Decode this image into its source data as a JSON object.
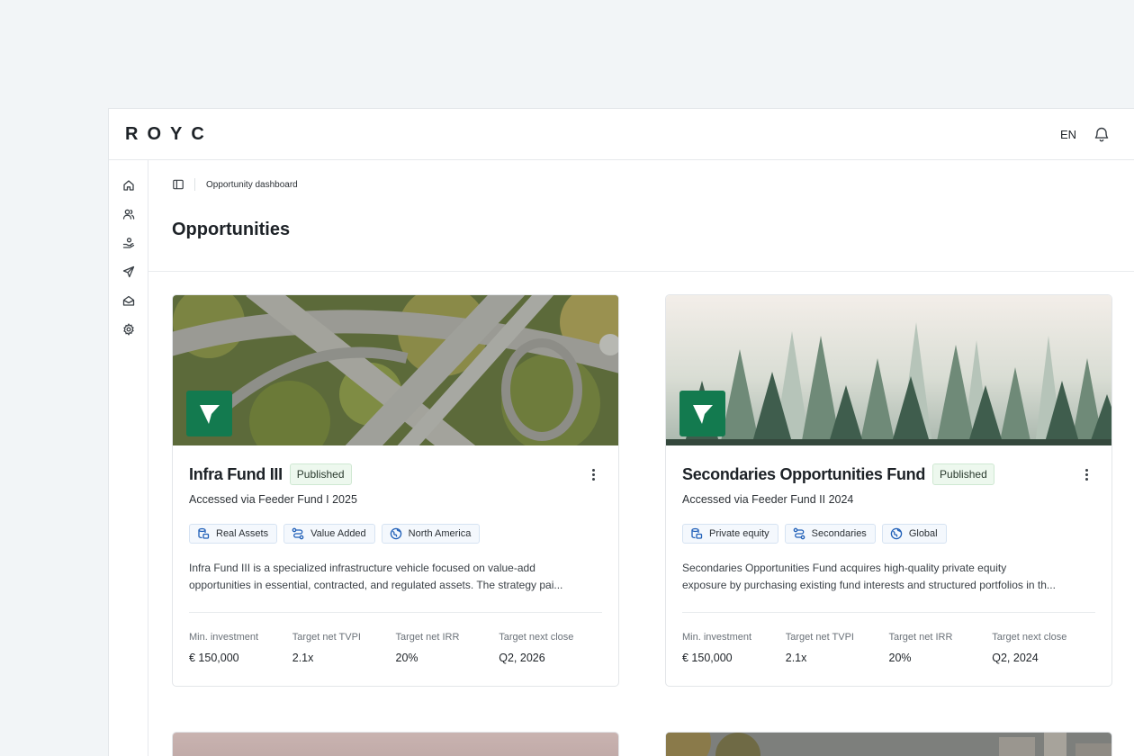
{
  "app": {
    "logo": "ROYC",
    "language": "EN"
  },
  "breadcrumb": {
    "current": "Opportunity dashboard"
  },
  "page": {
    "title": "Opportunities"
  },
  "cards": [
    {
      "title": "Infra Fund III",
      "status": "Published",
      "subtitle": "Accessed via Feeder Fund I 2025",
      "tags": [
        {
          "icon": "asset-class-icon",
          "label": "Real Assets"
        },
        {
          "icon": "strategy-icon",
          "label": "Value Added"
        },
        {
          "icon": "globe-icon",
          "label": "North America"
        }
      ],
      "description_line1": "Infra Fund III is a specialized infrastructure vehicle focused on value-add",
      "description_line2": "opportunities in essential, contracted, and regulated assets. The strategy pai...",
      "metrics": [
        {
          "label": "Min. investment",
          "value": "€ 150,000"
        },
        {
          "label": "Target net TVPI",
          "value": "2.1x"
        },
        {
          "label": "Target net IRR",
          "value": "20%"
        },
        {
          "label": "Target next close",
          "value": "Q2, 2026"
        }
      ]
    },
    {
      "title": "Secondaries Opportunities Fund",
      "status": "Published",
      "subtitle": "Accessed via Feeder Fund II 2024",
      "tags": [
        {
          "icon": "asset-class-icon",
          "label": "Private equity"
        },
        {
          "icon": "strategy-icon",
          "label": "Secondaries"
        },
        {
          "icon": "globe-icon",
          "label": "Global"
        }
      ],
      "description_line1": "Secondaries Opportunities Fund acquires high-quality private equity",
      "description_line2": "exposure by purchasing existing fund interests and structured portfolios in th...",
      "metrics": [
        {
          "label": "Min. investment",
          "value": "€ 150,000"
        },
        {
          "label": "Target net TVPI",
          "value": "2.1x"
        },
        {
          "label": "Target net IRR",
          "value": "20%"
        },
        {
          "label": "Target next close",
          "value": "Q2, 2024"
        }
      ]
    }
  ],
  "colors": {
    "accent": "#137a4f",
    "pill_bg": "#edf8ee",
    "tag_bg": "#f4f8fd",
    "tag_icon": "#1f5fb8"
  }
}
